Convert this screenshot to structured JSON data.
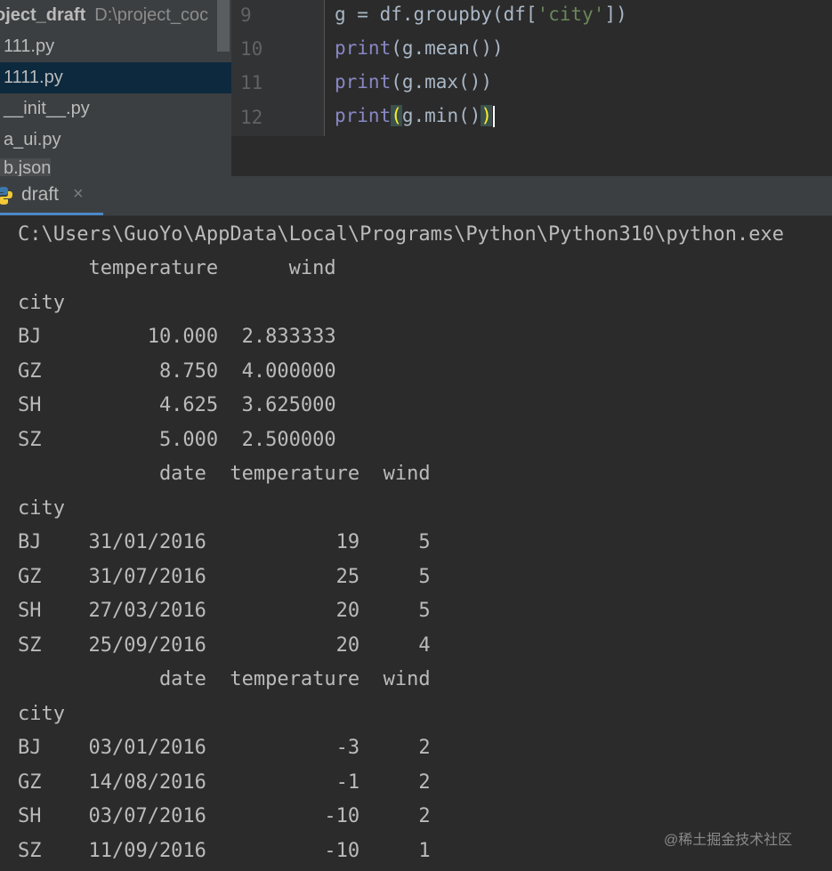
{
  "project": {
    "root_name": "oject_draft",
    "root_path": "D:\\project_coc",
    "files": [
      "111.py",
      "1111.py",
      "__init__.py",
      "a_ui.py",
      "b.json"
    ],
    "selected_index": 1
  },
  "editor": {
    "lines": [
      {
        "num": "9",
        "seg": [
          "g = df.groupby(df[",
          "'city'",
          "])"
        ]
      },
      {
        "num": "10",
        "seg": [
          "print",
          "(g.mean())"
        ]
      },
      {
        "num": "11",
        "seg": [
          "print",
          "(g.max())"
        ]
      },
      {
        "num": "12",
        "seg": [
          "print",
          "(",
          "g.min()",
          ")"
        ]
      }
    ]
  },
  "run_tab": {
    "label": "draft",
    "close": "×"
  },
  "console": {
    "lines": [
      "C:\\Users\\GuoYo\\AppData\\Local\\Programs\\Python\\Python310\\python.exe",
      "      temperature      wind",
      "city",
      "BJ         10.000  2.833333",
      "GZ          8.750  4.000000",
      "SH          4.625  3.625000",
      "SZ          5.000  2.500000",
      "            date  temperature  wind",
      "city",
      "BJ    31/01/2016           19     5",
      "GZ    31/07/2016           25     5",
      "SH    27/03/2016           20     5",
      "SZ    25/09/2016           20     4",
      "            date  temperature  wind",
      "city",
      "BJ    03/01/2016           -3     2",
      "GZ    14/08/2016           -1     2",
      "SH    03/07/2016          -10     2",
      "SZ    11/09/2016          -10     1"
    ]
  },
  "watermark": "@稀土掘金技术社区"
}
